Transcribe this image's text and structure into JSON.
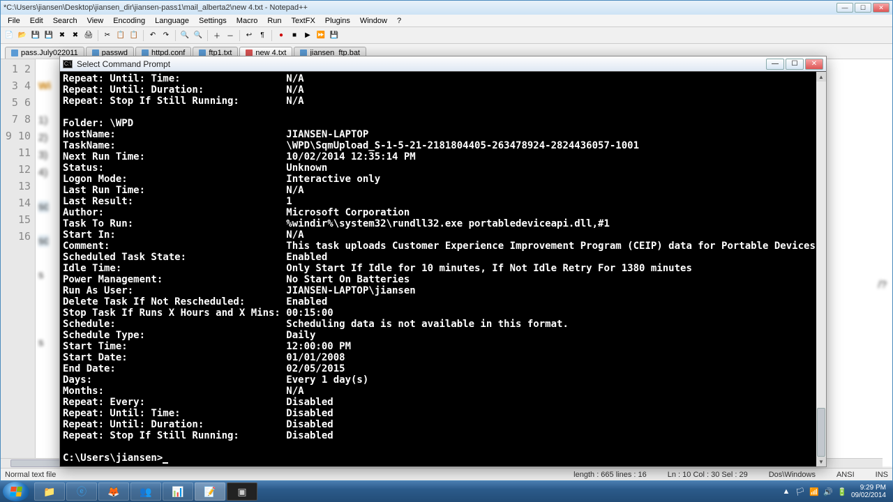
{
  "npp": {
    "title": "*C:\\Users\\jiansen\\Desktop\\jiansen_dir\\jiansen-pass1\\mail_alberta2\\new  4.txt - Notepad++",
    "menu": [
      "File",
      "Edit",
      "Search",
      "View",
      "Encoding",
      "Language",
      "Settings",
      "Macro",
      "Run",
      "TextFX",
      "Plugins",
      "Window",
      "?"
    ],
    "tabs": [
      {
        "label": "pass.July022011",
        "icon": "blue"
      },
      {
        "label": "passwd",
        "icon": "blue"
      },
      {
        "label": "httpd.conf",
        "icon": "blue"
      },
      {
        "label": "ftp1.txt",
        "icon": "blue"
      },
      {
        "label": "new  4.txt",
        "icon": "red",
        "active": true
      },
      {
        "label": "jiansen_ftp.bat",
        "icon": "blue"
      }
    ],
    "lines": [
      "1",
      "2",
      "3",
      "4",
      "5",
      "6",
      "7",
      "8",
      "9",
      "10",
      "11",
      "12",
      "13",
      "14",
      "15",
      "16"
    ],
    "editor": {
      "l1": "Wi",
      "l3": "1)",
      "l4": "2)",
      "l5": "3)",
      "l6": "4)",
      "l8": "sc",
      "l10": "sc",
      "l12": "s",
      "l13": "",
      "l14": "",
      "l16": "s",
      "tail14": "/?"
    },
    "status": {
      "left": "Normal text file",
      "length": "length : 665    lines : 16",
      "pos": "Ln : 10    Col : 30    Sel : 29",
      "eol": "Dos\\Windows",
      "enc": "ANSI",
      "ins": "INS"
    }
  },
  "cmd": {
    "title": "Select Command Prompt",
    "prompt": "C:\\Users\\jiansen>",
    "rows": [
      [
        "Repeat: Until: Time:",
        "N/A"
      ],
      [
        "Repeat: Until: Duration:",
        "N/A"
      ],
      [
        "Repeat: Stop If Still Running:",
        "N/A"
      ],
      [
        "",
        ""
      ],
      [
        "Folder: \\WPD",
        ""
      ],
      [
        "HostName:",
        "JIANSEN-LAPTOP"
      ],
      [
        "TaskName:",
        "\\WPD\\SqmUpload_S-1-5-21-2181804405-263478924-2824436057-1001"
      ],
      [
        "Next Run Time:",
        "10/02/2014 12:35:14 PM"
      ],
      [
        "Status:",
        "Unknown"
      ],
      [
        "Logon Mode:",
        "Interactive only"
      ],
      [
        "Last Run Time:",
        "N/A"
      ],
      [
        "Last Result:",
        "1"
      ],
      [
        "Author:",
        "Microsoft Corporation"
      ],
      [
        "Task To Run:",
        "%windir%\\system32\\rundll32.exe portabledeviceapi.dll,#1"
      ],
      [
        "Start In:",
        "N/A"
      ],
      [
        "Comment:",
        "This task uploads Customer Experience Improvement Program (CEIP) data for Portable Devices"
      ],
      [
        "Scheduled Task State:",
        "Enabled"
      ],
      [
        "Idle Time:",
        "Only Start If Idle for 10 minutes, If Not Idle Retry For 1380 minutes"
      ],
      [
        "Power Management:",
        "No Start On Batteries"
      ],
      [
        "Run As User:",
        "JIANSEN-LAPTOP\\jiansen"
      ],
      [
        "Delete Task If Not Rescheduled:",
        "Enabled"
      ],
      [
        "Stop Task If Runs X Hours and X Mins:",
        "00:15:00"
      ],
      [
        "Schedule:",
        "Scheduling data is not available in this format."
      ],
      [
        "Schedule Type:",
        "Daily"
      ],
      [
        "Start Time:",
        "12:00:00 PM"
      ],
      [
        "Start Date:",
        "01/01/2008"
      ],
      [
        "End Date:",
        "02/05/2015"
      ],
      [
        "Days:",
        "Every 1 day(s)"
      ],
      [
        "Months:",
        "N/A"
      ],
      [
        "Repeat: Every:",
        "Disabled"
      ],
      [
        "Repeat: Until: Time:",
        "Disabled"
      ],
      [
        "Repeat: Until: Duration:",
        "Disabled"
      ],
      [
        "Repeat: Stop If Still Running:",
        "Disabled"
      ]
    ]
  },
  "taskbar": {
    "time": "9:29 PM",
    "date": "09/02/2014"
  }
}
